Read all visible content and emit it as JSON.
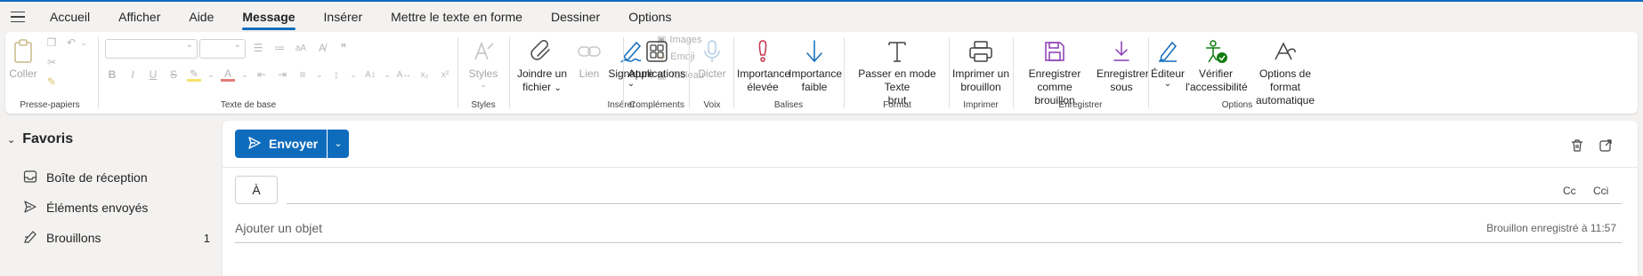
{
  "menu": {
    "tabs": [
      "Accueil",
      "Afficher",
      "Aide",
      "Message",
      "Insérer",
      "Mettre le texte en forme",
      "Dessiner",
      "Options"
    ],
    "active": "Message"
  },
  "ribbon": {
    "clipboard": {
      "paste_label": "Coller",
      "group_label": "Presse-papiers"
    },
    "basic_text": {
      "group_label": "Texte de base"
    },
    "styles": {
      "button_label": "Styles",
      "group_label": "Styles"
    },
    "insert": {
      "attach_line1": "Joindre un",
      "attach_line2": "fichier",
      "link_label": "Lien",
      "signature_label": "Signature",
      "images_label": "Images",
      "emoji_label": "Emoji",
      "table_label": "Tableau",
      "group_label": "Insérer"
    },
    "addins": {
      "apps_label": "Applications",
      "group_label": "Compléments"
    },
    "voice": {
      "dictate_label": "Dicter",
      "group_label": "Voix"
    },
    "tags": {
      "high_line1": "Importance",
      "high_line2": "élevée",
      "low_line1": "Importance",
      "low_line2": "faible",
      "group_label": "Balises"
    },
    "format": {
      "plain_line1": "Passer en mode Texte",
      "plain_line2": "brut",
      "group_label": "Format"
    },
    "print": {
      "print_line1": "Imprimer un",
      "print_line2": "brouillon",
      "group_label": "Imprimer"
    },
    "save": {
      "draft_line1": "Enregistrer comme",
      "draft_line2": "brouillon",
      "saveas_line1": "Enregistrer",
      "saveas_line2": "sous",
      "group_label": "Enregistrer"
    },
    "options": {
      "editor_label": "Éditeur",
      "access_line1": "Vérifier",
      "access_line2": "l'accessibilité",
      "autoformat_line1": "Options de format",
      "autoformat_line2": "automatique",
      "group_label": "Options"
    }
  },
  "nav": {
    "favorites_label": "Favoris",
    "items": [
      {
        "label": "Boîte de réception",
        "count": ""
      },
      {
        "label": "Éléments envoyés",
        "count": ""
      },
      {
        "label": "Brouillons",
        "count": "1"
      }
    ]
  },
  "compose": {
    "send_label": "Envoyer",
    "to_label": "À",
    "cc_label": "Cc",
    "bcc_label": "Cci",
    "subject_placeholder": "Ajouter un objet",
    "saved_status": "Brouillon enregistré à 11:57"
  },
  "colors": {
    "accent": "#0f6cbd",
    "purple": "#8a3cb3",
    "red": "#c4314b",
    "green": "#107c10"
  }
}
